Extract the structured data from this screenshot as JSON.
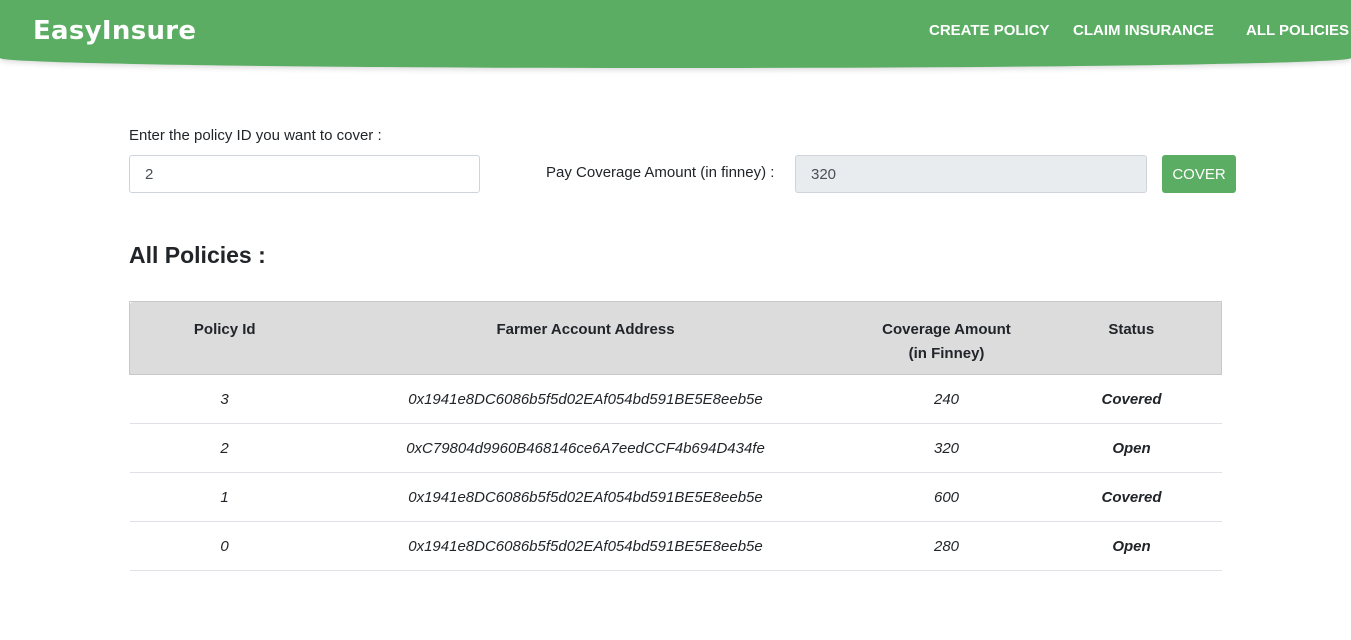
{
  "navbar": {
    "brand": "EasyInsure",
    "links": [
      "CREATE POLICY",
      "CLAIM INSURANCE",
      "ALL POLICIES"
    ]
  },
  "cover_form": {
    "policy_label": "Enter the policy ID you want to cover :",
    "policy_value": "2",
    "pay_label": "Pay Coverage Amount (in finney) :",
    "coverage_value": "320",
    "button_label": "COVER"
  },
  "policies": {
    "title": "All Policies :",
    "headers": {
      "policy_id": "Policy Id",
      "farmer_address": "Farmer Account Address",
      "coverage_line1": "Coverage Amount",
      "coverage_line2": "(in Finney)",
      "status": "Status"
    },
    "rows": [
      {
        "id": "3",
        "address": "0x1941e8DC6086b5f5d02EAf054bd591BE5E8eeb5e",
        "amount": "240",
        "status": "Covered",
        "status_type": "covered"
      },
      {
        "id": "2",
        "address": "0xC79804d9960B468146ce6A7eedCCF4b694D434fe",
        "amount": "320",
        "status": "Open",
        "status_type": "open"
      },
      {
        "id": "1",
        "address": "0x1941e8DC6086b5f5d02EAf054bd591BE5E8eeb5e",
        "amount": "600",
        "status": "Covered",
        "status_type": "covered"
      },
      {
        "id": "0",
        "address": "0x1941e8DC6086b5f5d02EAf054bd591BE5E8eeb5e",
        "amount": "280",
        "status": "Open",
        "status_type": "open"
      }
    ]
  },
  "colors": {
    "brand_green": "#5bad63",
    "covered_gray": "#6c757d",
    "header_gray": "#dcdcdc"
  }
}
